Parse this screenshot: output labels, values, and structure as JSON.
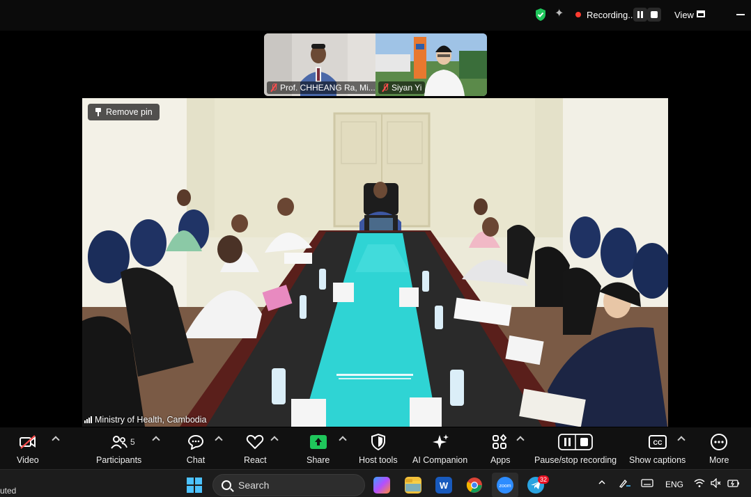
{
  "topbar": {
    "recording_label": "Recording...",
    "view_label": "View"
  },
  "gallery": [
    {
      "name": "Prof. CHHEANG Ra, Mi...",
      "muted": true
    },
    {
      "name": "Siyan Yi",
      "muted": true
    }
  ],
  "main": {
    "remove_pin_label": "Remove pin",
    "speaker_name": "Ministry of Health, Cambodia"
  },
  "toolbar": {
    "video_label": "Video",
    "participants_label": "Participants",
    "participants_count": "5",
    "chat_label": "Chat",
    "react_label": "React",
    "share_label": "Share",
    "host_tools_label": "Host tools",
    "ai_companion_label": "AI Companion",
    "apps_label": "Apps",
    "pause_stop_label": "Pause/stop recording",
    "captions_label": "Show captions",
    "more_label": "More"
  },
  "taskbar": {
    "left_status": "uted",
    "search_label": "Search",
    "telegram_badge": "32",
    "language": "ENG",
    "zoom_app_label": "zoom"
  },
  "colors": {
    "accent_green": "#1fc65b",
    "muted_red": "#ff4d4d",
    "record_red": "#ff3b30",
    "windows_blue": "#4cc2ff"
  }
}
